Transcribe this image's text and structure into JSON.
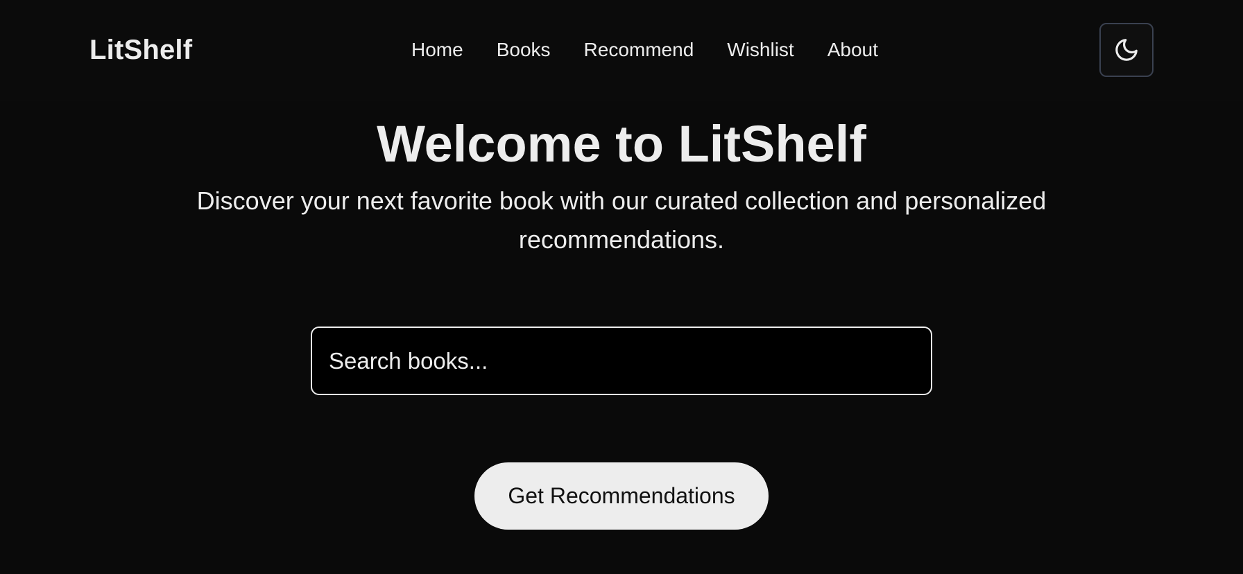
{
  "brand": {
    "name": "LitShelf"
  },
  "nav": {
    "links": [
      "Home",
      "Books",
      "Recommend",
      "Wishlist",
      "About"
    ]
  },
  "theme_toggle": {
    "icon": "moon-icon"
  },
  "hero": {
    "title": "Welcome to LitShelf",
    "subtitle": "Discover your next favorite book with our curated collection and personalized recommendations."
  },
  "search": {
    "placeholder": "Search books...",
    "value": ""
  },
  "cta": {
    "label": "Get Recommendations"
  },
  "colors": {
    "background": "#0a0a0a",
    "foreground": "#ededed",
    "toggle_border": "#3a4150",
    "button_text": "#111111"
  }
}
